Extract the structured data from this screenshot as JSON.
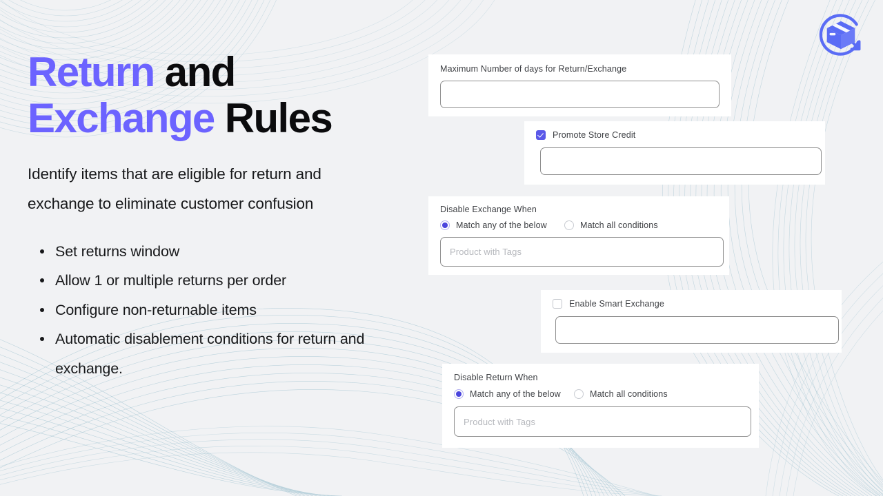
{
  "colors": {
    "accent_purple": "#6c63ff",
    "checkbox_blue": "#5a58e8",
    "radio_dot": "#4b45dd",
    "page_background": "#f1f2f4",
    "card_background": "#ffffff",
    "deco_line": "#8fb9c9"
  },
  "logo": {
    "icon": "return-box-cycle-icon"
  },
  "hero": {
    "headline": {
      "line1_accent": "Return",
      "line1_plain": " and",
      "line2_accent": "Exchange",
      "line2_plain": " Rules"
    },
    "subtitle": "Identify items that are eligible for return and exchange to eliminate customer confusion",
    "bullets": [
      "Set returns window",
      "Allow 1 or multiple returns per order",
      "Configure non-returnable items",
      "Automatic disablement conditions for return and exchange."
    ]
  },
  "cards": [
    {
      "id": "max-days",
      "label": "Maximum Number of days for Return/Exchange",
      "input": {
        "value": "",
        "placeholder": ""
      }
    },
    {
      "id": "promote-store-credit",
      "label": "Promote Store Credit",
      "checked": true,
      "input": {
        "value": "",
        "placeholder": ""
      }
    },
    {
      "id": "disable-exchange-when",
      "label": "Disable Exchange When",
      "radio_options": [
        {
          "label": "Match any of the below",
          "selected": true
        },
        {
          "label": "Match all conditions",
          "selected": false
        }
      ],
      "input": {
        "value": "",
        "placeholder": "Product with Tags"
      }
    },
    {
      "id": "enable-smart-exchange",
      "label": "Enable Smart Exchange",
      "checked": false,
      "input": {
        "value": "",
        "placeholder": ""
      }
    },
    {
      "id": "disable-return-when",
      "label": "Disable Return When",
      "radio_options": [
        {
          "label": "Match any of the below",
          "selected": true
        },
        {
          "label": "Match all conditions",
          "selected": false
        }
      ],
      "input": {
        "value": "",
        "placeholder": "Product with Tags"
      }
    }
  ]
}
